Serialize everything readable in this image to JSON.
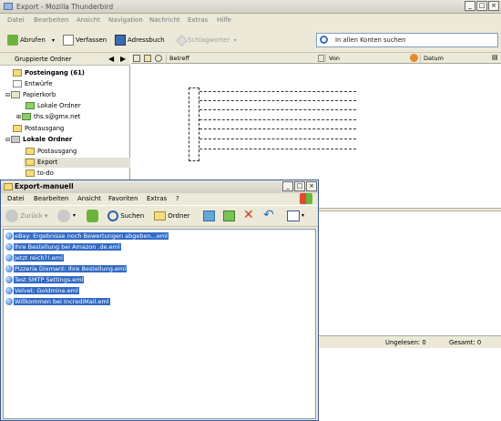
{
  "thunderbird": {
    "title": "Export - Mozilla Thunderbird",
    "menu": [
      "Datei",
      "Bearbeiten",
      "Ansicht",
      "Navigation",
      "Nachricht",
      "Extras",
      "Hilfe"
    ],
    "toolbar": {
      "abrufen": "Abrufen",
      "verfassen": "Verfassen",
      "adressbuch": "Adressbuch",
      "schlagworter": "Schlagworter"
    },
    "search_placeholder": "In allen Konten suchen",
    "folder_header": "Gruppierte Ordner",
    "folders": [
      {
        "label": "Posteingang (61)",
        "bold": true
      },
      {
        "label": "Entwürfe"
      },
      {
        "label": "Papierkorb"
      },
      {
        "label": "Lokale Ordner"
      },
      {
        "label": "ths.s@gmx.net"
      },
      {
        "label": "Postausgang"
      },
      {
        "label": "Lokale Ordner",
        "bold": true
      },
      {
        "label": "Postausgang"
      },
      {
        "label": "Export",
        "selected": true
      },
      {
        "label": "to-do"
      }
    ],
    "columns": {
      "betreff": "Betreff",
      "von": "Von",
      "datum": "Datum"
    },
    "status": {
      "unread": "Ungelesen: 0",
      "total": "Gesamt: 0"
    }
  },
  "explorer": {
    "title": "Export-manuell",
    "menu": [
      "Datei",
      "Bearbeiten",
      "Ansicht",
      "Favoriten",
      "Extras",
      "?"
    ],
    "back": "Zurück",
    "search": "Suchen",
    "folders": "Ordner",
    "files": [
      "eBay: Ergebnisse noch Bewertungen abgeben...eml",
      "Ihre Bestellung bei Amazon .de.eml",
      "Jetzt reich?!.eml",
      "Pizzeria Dixmant: Ihre Bestellung.eml",
      "Test SMTP Settings.eml",
      "Velvet: Goldmine.eml",
      "Willkommen bei IncrediMail.eml"
    ]
  }
}
